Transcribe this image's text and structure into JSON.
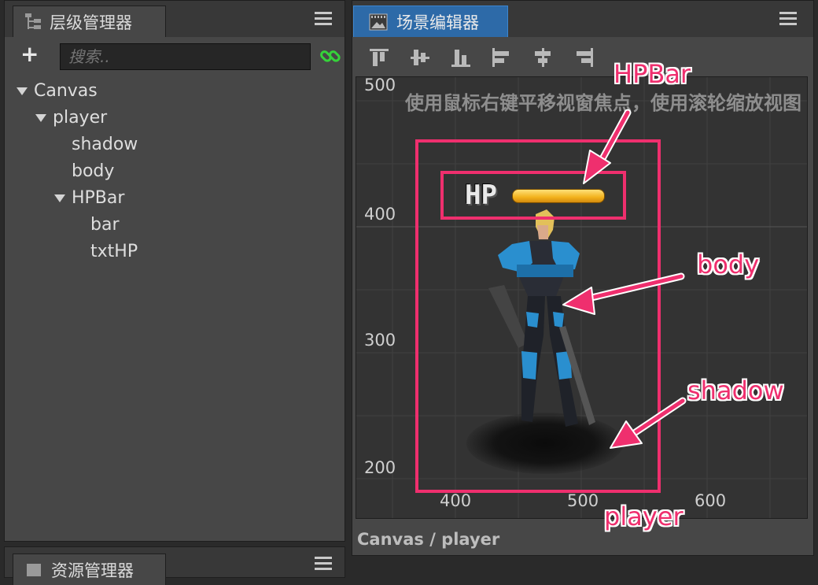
{
  "hierarchy": {
    "title": "层级管理器",
    "add_label": "+",
    "search_placeholder": "搜索..",
    "tree": [
      {
        "label": "Canvas"
      },
      {
        "label": "player"
      },
      {
        "label": "shadow"
      },
      {
        "label": "body"
      },
      {
        "label": "HPBar"
      },
      {
        "label": "bar"
      },
      {
        "label": "txtHP"
      }
    ]
  },
  "assets": {
    "title": "资源管理器"
  },
  "scene": {
    "title": "场景编辑器",
    "hint": "使用鼠标右键平移视窗焦点，使用滚轮缩放视图",
    "y_ticks": [
      "500",
      "400",
      "300",
      "200"
    ],
    "x_ticks": [
      "400",
      "500",
      "600"
    ],
    "hp_label": "HP",
    "breadcrumb": "Canvas / player"
  },
  "annotations": {
    "hpbar": "HPBar",
    "body": "body",
    "shadow": "shadow",
    "player": "player"
  },
  "colors": {
    "annotation": "#ef2f6e",
    "tab_active": "#2d6aa8",
    "link_icon": "#35d33a"
  },
  "icons": [
    "hierarchy-icon",
    "menu-icon",
    "add-icon",
    "link-icon",
    "scene-icon",
    "align-top-icon",
    "align-vcenter-icon",
    "align-bottom-icon",
    "align-left-icon",
    "align-hcenter-icon",
    "align-right-icon",
    "assets-icon"
  ]
}
